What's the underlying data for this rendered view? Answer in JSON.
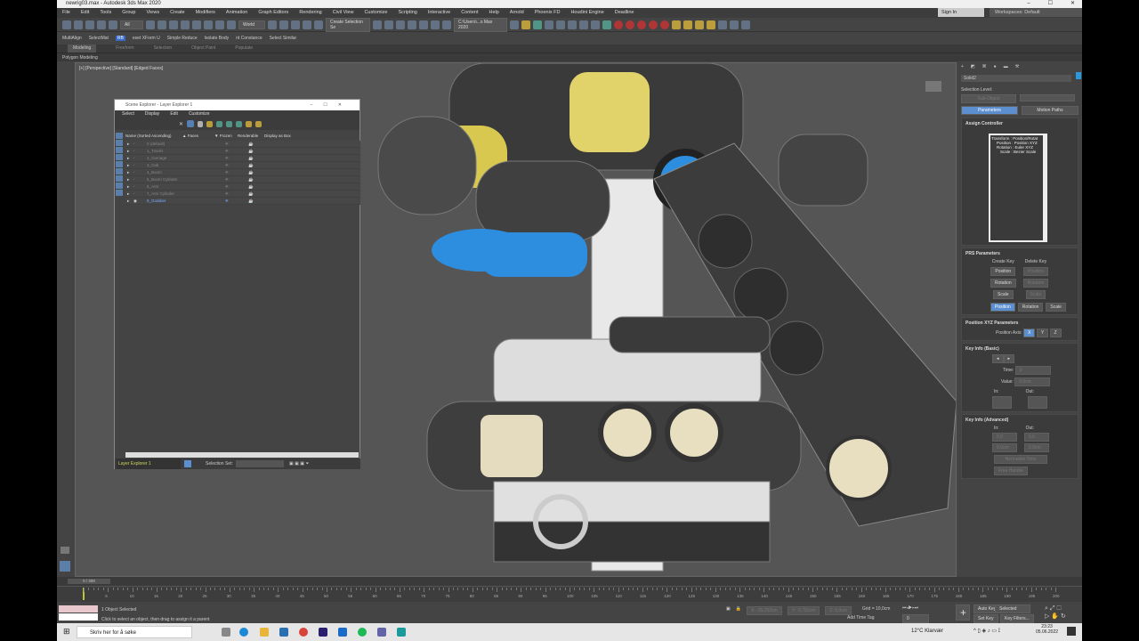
{
  "window": {
    "title": "newrig03.max - Autodesk 3ds Max 2020",
    "minimize": "–",
    "maximize": "☐",
    "close": "✕"
  },
  "menu": [
    "File",
    "Edit",
    "Tools",
    "Group",
    "Views",
    "Create",
    "Modifiers",
    "Animation",
    "Graph Editors",
    "Rendering",
    "Civil View",
    "Customize",
    "Scripting",
    "Interactive",
    "Content",
    "Help",
    "Arnold",
    "Phoenix FD",
    "Houdini Engine",
    "Deadline"
  ],
  "signin": "Sign In",
  "workspace": "Workspaces: Default",
  "toolbar": {
    "filter": "All",
    "coord": "World",
    "selection_set": "Create Selection Se",
    "path": "C:\\Users\\...s Max 2020"
  },
  "toolbar2": [
    "MultiAlign",
    "SelectMat",
    "RB",
    "eset XForm U",
    "Simple Reduce",
    "Isolate Body",
    "nt Constance",
    "Select Similar"
  ],
  "ribbon": {
    "tabs": [
      "Modeling",
      "Freeform",
      "Selection",
      "Object Paint",
      "Populate"
    ],
    "sub": "Polygon Modeling"
  },
  "viewport": {
    "label": "[+] [Perspective] [Standard] [Edged Faces]"
  },
  "scene_explorer": {
    "title": "Scene Explorer - Layer Explorer 1",
    "menu": [
      "Select",
      "Display",
      "Edit",
      "Customize"
    ],
    "columns": [
      "Name (Sorted Ascending)",
      "▲ Faces",
      "▼ Frozen",
      "Renderable",
      "Display as Box"
    ],
    "layers": [
      "0 (default)",
      "1_Tracks",
      "2_Carriage",
      "3_Cab",
      "4_Boom",
      "5_Boom Cylinder",
      "6_Arm",
      "7_Arm Cylinder",
      "8_Grabber"
    ],
    "explorer_name": "Layer Explorer 1",
    "selection_set_label": "Selection Set:"
  },
  "command_panel": {
    "object_name": "Solid2",
    "selection_level": "Selection Level:",
    "sub_object": "Sub-Object",
    "parameters": "Parameters",
    "motion_paths": "Motion Paths",
    "assign_controller": "Assign Controller",
    "tree": [
      "Transform : Position/Rotat",
      "Position : Position XYZ",
      "Rotation : Euler XYZ",
      "Scale : Bezier Scale"
    ],
    "prs": "PRS Parameters",
    "create_key": "Create Key",
    "delete_key": "Delete Key",
    "position": "Position",
    "rotation": "Rotation",
    "scale": "Scale",
    "pos_xyz": "Position XYZ Parameters",
    "pos_axis": "Position Axis:",
    "axes": [
      "X",
      "Y",
      "Z"
    ],
    "key_basic": "Key Info (Basic)",
    "time": "Time:",
    "time_val": "0",
    "value": "Value:",
    "value_val": "0,0cm",
    "in": "In:",
    "out": "Out:",
    "key_adv": "Key Info (Advanced)",
    "adv_vals": [
      "0,0",
      "0,0",
      "0,0cm",
      "0,0cm"
    ],
    "normalize": "Normalize Time",
    "free_handle": "Free Handle"
  },
  "timeline": {
    "frame": "0 / 200",
    "ticks": [
      0,
      5,
      10,
      15,
      20,
      25,
      30,
      35,
      40,
      45,
      50,
      55,
      60,
      65,
      70,
      75,
      80,
      85,
      90,
      95,
      100,
      105,
      110,
      115,
      120,
      125,
      130,
      135,
      140,
      145,
      150,
      155,
      160,
      165,
      170,
      175,
      180,
      185,
      190,
      195,
      200
    ],
    "progress": 0
  },
  "status": {
    "selected": "1 Object Selected",
    "prompt": "Click to select an object, then drag to assign it a parent",
    "x": "X: -25,252cm",
    "y": "Y: -5,702cm",
    "z": "Z: 0,0cm",
    "grid": "Grid = 10,0cm",
    "add_time_tag": "Add Time Tag",
    "frame": "0",
    "auto_key": "Auto Key",
    "set_key": "Set Key",
    "selected_dd": "Selected",
    "key_filters": "Key Filters..."
  },
  "taskbar": {
    "search": "Skriv her for å søke",
    "weather": "12°C  Klarvær",
    "time": "23:23",
    "date": "05.06.2022"
  }
}
